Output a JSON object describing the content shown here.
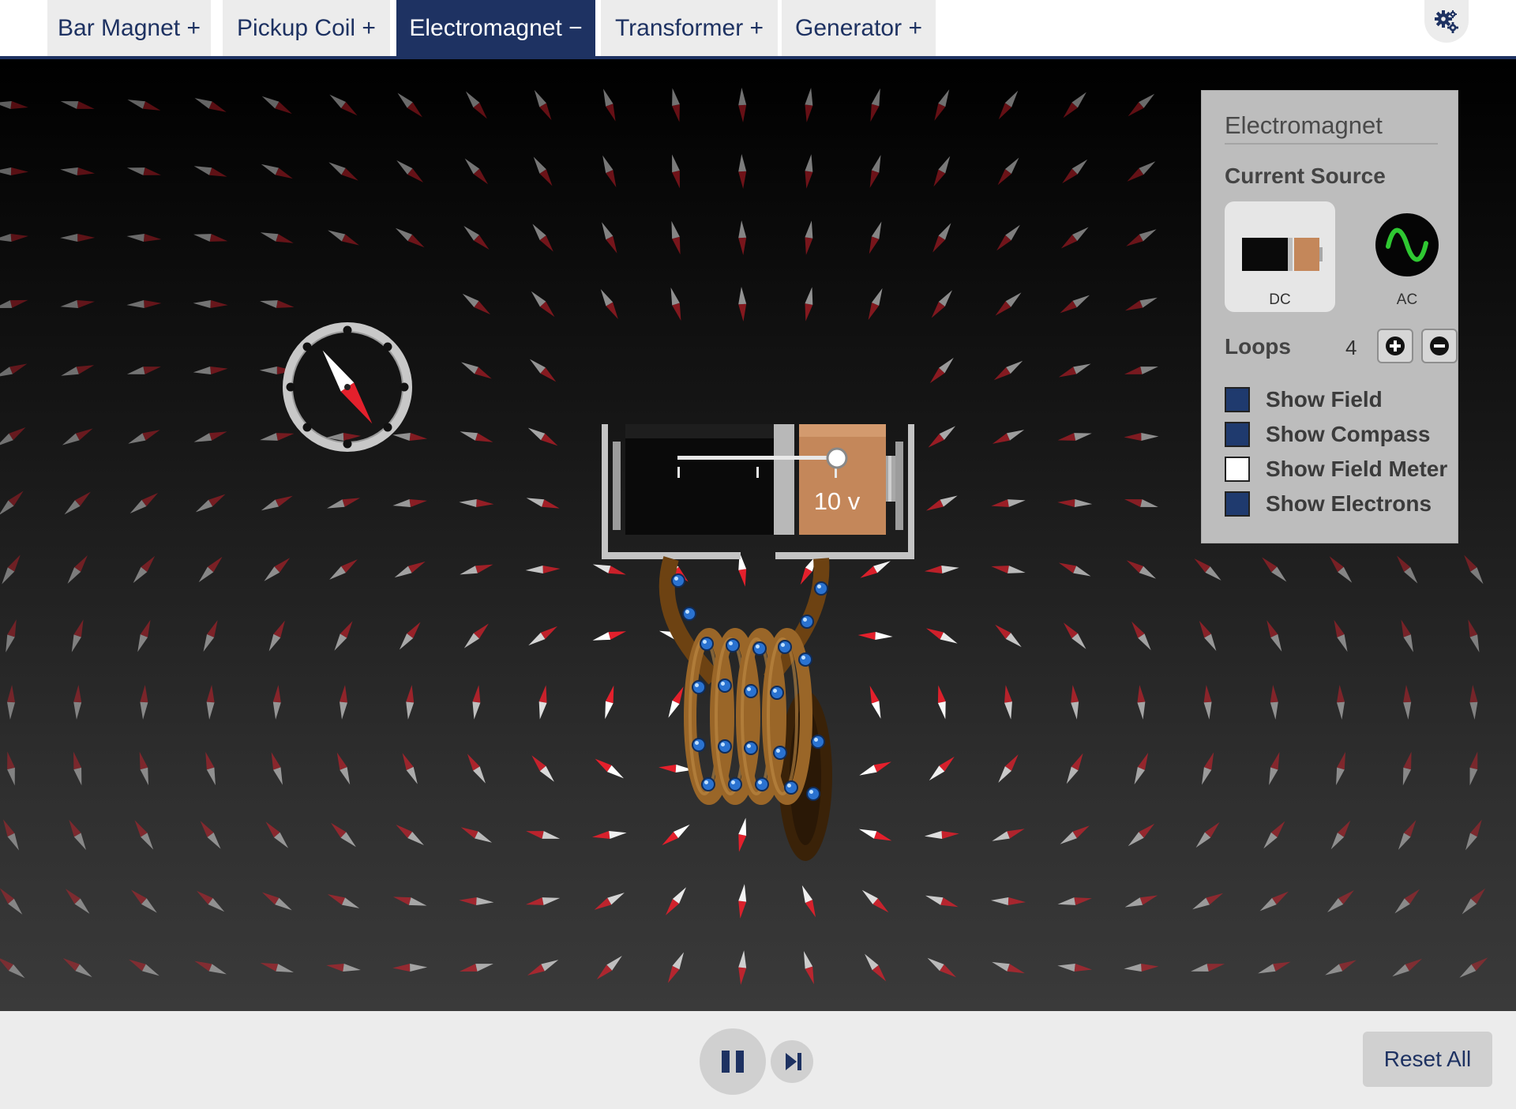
{
  "tabs": [
    {
      "label": "Bar Magnet +",
      "active": false
    },
    {
      "label": "Pickup Coil +",
      "active": false
    },
    {
      "label": "Electromagnet −",
      "active": true
    },
    {
      "label": "Transformer +",
      "active": false
    },
    {
      "label": "Generator +",
      "active": false
    }
  ],
  "settings_icon": "gear-icon",
  "battery": {
    "voltage_label": "10 v",
    "voltage": 10
  },
  "coil": {
    "loops": 4
  },
  "panel": {
    "title": "Electromagnet",
    "current_source_label": "Current Source",
    "sources": [
      {
        "label": "DC",
        "selected": true,
        "icon": "battery-icon"
      },
      {
        "label": "AC",
        "selected": false,
        "icon": "ac-wave-icon"
      }
    ],
    "loops_label": "Loops",
    "loops_value": "4",
    "checkboxes": [
      {
        "label": "Show Field",
        "checked": true
      },
      {
        "label": "Show Compass",
        "checked": true
      },
      {
        "label": "Show Field Meter",
        "checked": false
      },
      {
        "label": "Show Electrons",
        "checked": true
      }
    ]
  },
  "controls": {
    "play_pause_icon": "pause-icon",
    "step_icon": "step-forward-icon",
    "reset_label": "Reset All"
  },
  "colors": {
    "brand_navy": "#1e3262",
    "needle_north": "#e4202c",
    "needle_south": "#ffffff",
    "coil_copper": "#8a5a1e",
    "electron_blue": "#2a72d0",
    "battery_copper": "#c4875a"
  }
}
